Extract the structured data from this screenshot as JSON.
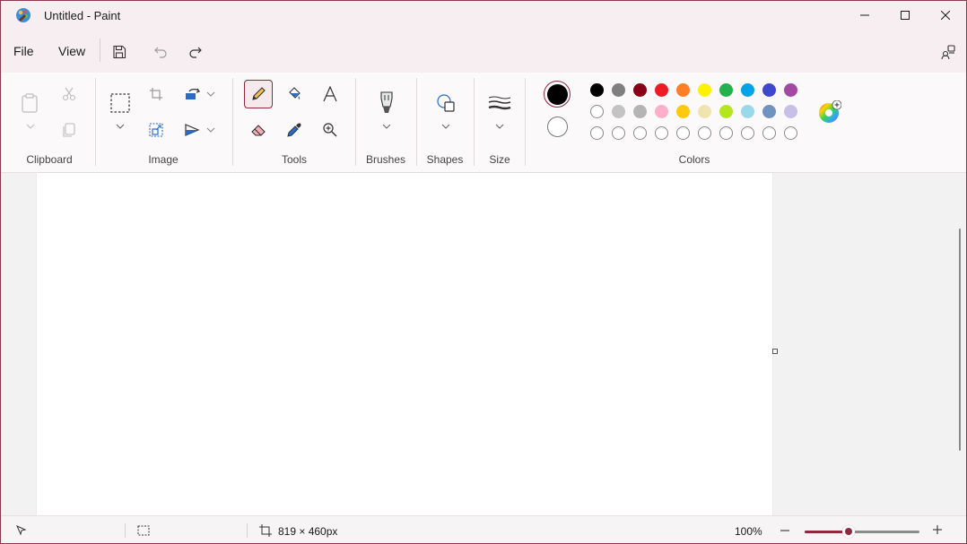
{
  "window": {
    "title": "Untitled - Paint"
  },
  "menu": {
    "file": "File",
    "view": "View"
  },
  "ribbon": {
    "groups": {
      "clipboard": "Clipboard",
      "image": "Image",
      "tools": "Tools",
      "brushes": "Brushes",
      "shapes": "Shapes",
      "size": "Size",
      "colors": "Colors"
    },
    "active_tool": "pencil",
    "primary_color": "#000000",
    "secondary_color": "#ffffff",
    "palette_row1": [
      "#000000",
      "#7f7f7f",
      "#880015",
      "#ed1c24",
      "#ff7f27",
      "#fff200",
      "#22b14c",
      "#00a2e8",
      "#3f48cc",
      "#a349a4"
    ],
    "palette_row2": [
      "#ffffff",
      "#c3c3c3",
      "#b4b4b4",
      "#ffaec9",
      "#ffc90e",
      "#efe4b0",
      "#b5e61d",
      "#99d9ea",
      "#7092be",
      "#c8bfe7"
    ],
    "palette_row3": [
      "",
      "",
      "",
      "",
      "",
      "",
      "",
      "",
      "",
      ""
    ],
    "accent": "#8a2a3c"
  },
  "status": {
    "canvas_size": "819 × 460px",
    "zoom": "100%",
    "zoom_level": 0.38
  }
}
